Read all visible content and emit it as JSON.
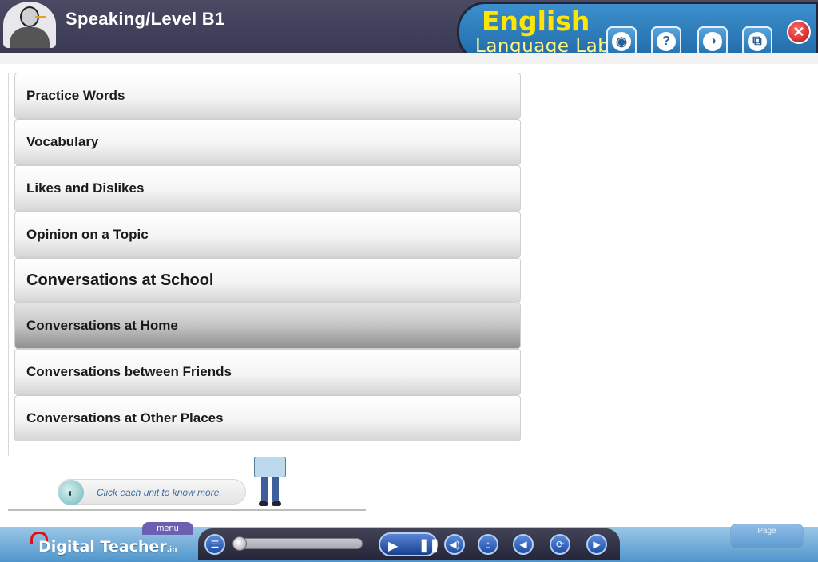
{
  "header": {
    "title": "Speaking/Level B1",
    "brand_main": "English",
    "brand_sub": "Language Lab",
    "tools": [
      {
        "name": "bookmark-icon",
        "glyph": "◉"
      },
      {
        "name": "help-icon",
        "glyph": "?"
      },
      {
        "name": "disc-icon",
        "glyph": "◑"
      },
      {
        "name": "window-icon",
        "glyph": "⧉"
      }
    ],
    "close_glyph": "✕"
  },
  "menu": {
    "items": [
      "Practice Words",
      "Vocabulary",
      "Likes and Dislikes",
      "Opinion on a Topic",
      "Conversations at School",
      "Conversations at Home",
      "Conversations between Friends",
      "Conversations at Other Places"
    ],
    "active_index": 5,
    "enlarged_index": 4
  },
  "hint": {
    "text": "Click each unit to know more."
  },
  "footer": {
    "logo_text": "Digital Teacher",
    "logo_suffix": ".in",
    "menu_tab": "menu",
    "page_label": "Page",
    "controls": {
      "menu_glyph": "☰",
      "play_glyph": "▶",
      "pause_glyph": "❚❚",
      "volume_glyph": "◀)",
      "home_glyph": "⌂",
      "back_glyph": "◀",
      "replay_glyph": "⟳",
      "next_glyph": "▶"
    },
    "progress": 0
  },
  "colors": {
    "header_bg": "#3f3e57",
    "brand_yellow": "#ffe600",
    "panel_blue": "#2a7cbd",
    "close_red": "#d01818"
  }
}
